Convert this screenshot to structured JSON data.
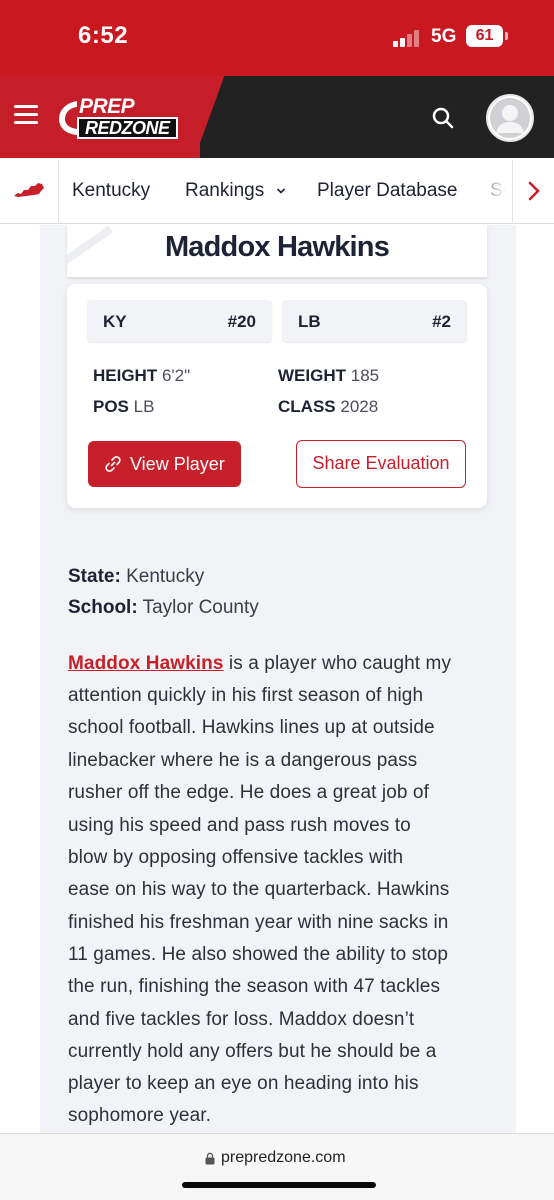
{
  "status_bar": {
    "time": "6:52",
    "network": "5G",
    "battery": "61"
  },
  "header": {
    "logo_top": "PREP",
    "logo_bottom": "REDZONE",
    "brand_color": "#c51e28"
  },
  "nav": {
    "items": [
      "Kentucky",
      "Rankings",
      "Player Database",
      "Sc"
    ],
    "rankings_dropdown": "›"
  },
  "player": {
    "name": "Maddox Hawkins",
    "state_rank": {
      "label": "KY",
      "value": "#20"
    },
    "position_rank": {
      "label": "LB",
      "value": "#2"
    },
    "height_label": "HEIGHT",
    "height": "6'2\"",
    "weight_label": "WEIGHT",
    "weight": "185",
    "pos_label": "POS",
    "pos": "LB",
    "class_label": "CLASS",
    "class_year": "2028"
  },
  "buttons": {
    "view_player": "View Player",
    "share_evaluation": "Share Evaluation"
  },
  "meta": {
    "state_label": "State:",
    "state": "Kentucky",
    "school_label": "School:",
    "school": "Taylor County"
  },
  "article": {
    "link_text": "Maddox Hawkins",
    "first_line_rest": " is a player who caught my",
    "lines": [
      "attention quickly in his first season of high",
      "school football. Hawkins lines up at outside",
      "linebacker where he is a dangerous pass",
      "rusher off the edge. He does a great job of",
      "using his speed and pass rush moves to",
      "blow by opposing offensive tackles with",
      "ease on his way to the quarterback. Hawkins",
      "finished his freshman year with nine sacks in",
      "11 games. He also showed the ability to stop",
      "the run, finishing the season with 47 tackles",
      "and five tackles for loss. Maddox doesn’t",
      "currently hold any offers but he should be a",
      "player to keep an eye on heading into his",
      "sophomore year."
    ]
  },
  "browser": {
    "url": "prepredzone.com"
  }
}
